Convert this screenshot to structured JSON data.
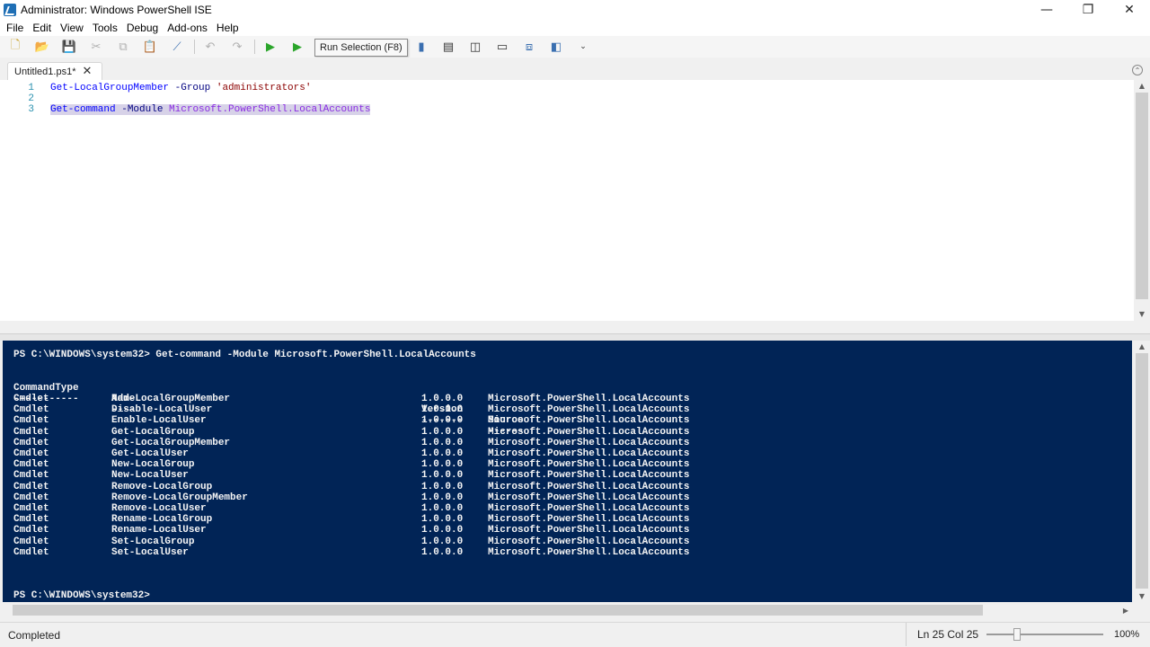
{
  "window": {
    "title": "Administrator: Windows PowerShell ISE",
    "minimize": "—",
    "restore": "❐",
    "close": "✕"
  },
  "menu": [
    "File",
    "Edit",
    "View",
    "Tools",
    "Debug",
    "Add-ons",
    "Help"
  ],
  "toolbar": {
    "tooltip": "Run Selection (F8)"
  },
  "tab": {
    "label": "Untitled1.ps1*",
    "close": "✕"
  },
  "editor": {
    "lines": [
      {
        "num": "1",
        "cmd": "Get-LocalGroupMember",
        "param": " -Group ",
        "arg": "'administrators'"
      },
      {
        "num": "2",
        "cmd": "",
        "param": "",
        "arg": ""
      },
      {
        "num": "3",
        "cmd": "Get-command",
        "param": " -Module ",
        "arg": "Microsoft.PowerShell.LocalAccounts"
      }
    ]
  },
  "console": {
    "command_line": "PS C:\\WINDOWS\\system32> Get-command -Module Microsoft.PowerShell.LocalAccounts",
    "headers": {
      "type": "CommandType",
      "name": "Name",
      "version": "Version",
      "source": "Source"
    },
    "underlines": {
      "type": "-----------",
      "name": "----",
      "version": "-------",
      "source": "------"
    },
    "rows": [
      {
        "type": "Cmdlet",
        "name": "Add-LocalGroupMember",
        "version": "1.0.0.0",
        "source": "Microsoft.PowerShell.LocalAccounts"
      },
      {
        "type": "Cmdlet",
        "name": "Disable-LocalUser",
        "version": "1.0.0.0",
        "source": "Microsoft.PowerShell.LocalAccounts"
      },
      {
        "type": "Cmdlet",
        "name": "Enable-LocalUser",
        "version": "1.0.0.0",
        "source": "Microsoft.PowerShell.LocalAccounts"
      },
      {
        "type": "Cmdlet",
        "name": "Get-LocalGroup",
        "version": "1.0.0.0",
        "source": "Microsoft.PowerShell.LocalAccounts"
      },
      {
        "type": "Cmdlet",
        "name": "Get-LocalGroupMember",
        "version": "1.0.0.0",
        "source": "Microsoft.PowerShell.LocalAccounts"
      },
      {
        "type": "Cmdlet",
        "name": "Get-LocalUser",
        "version": "1.0.0.0",
        "source": "Microsoft.PowerShell.LocalAccounts"
      },
      {
        "type": "Cmdlet",
        "name": "New-LocalGroup",
        "version": "1.0.0.0",
        "source": "Microsoft.PowerShell.LocalAccounts"
      },
      {
        "type": "Cmdlet",
        "name": "New-LocalUser",
        "version": "1.0.0.0",
        "source": "Microsoft.PowerShell.LocalAccounts"
      },
      {
        "type": "Cmdlet",
        "name": "Remove-LocalGroup",
        "version": "1.0.0.0",
        "source": "Microsoft.PowerShell.LocalAccounts"
      },
      {
        "type": "Cmdlet",
        "name": "Remove-LocalGroupMember",
        "version": "1.0.0.0",
        "source": "Microsoft.PowerShell.LocalAccounts"
      },
      {
        "type": "Cmdlet",
        "name": "Remove-LocalUser",
        "version": "1.0.0.0",
        "source": "Microsoft.PowerShell.LocalAccounts"
      },
      {
        "type": "Cmdlet",
        "name": "Rename-LocalGroup",
        "version": "1.0.0.0",
        "source": "Microsoft.PowerShell.LocalAccounts"
      },
      {
        "type": "Cmdlet",
        "name": "Rename-LocalUser",
        "version": "1.0.0.0",
        "source": "Microsoft.PowerShell.LocalAccounts"
      },
      {
        "type": "Cmdlet",
        "name": "Set-LocalGroup",
        "version": "1.0.0.0",
        "source": "Microsoft.PowerShell.LocalAccounts"
      },
      {
        "type": "Cmdlet",
        "name": "Set-LocalUser",
        "version": "1.0.0.0",
        "source": "Microsoft.PowerShell.LocalAccounts"
      }
    ],
    "prompt": "PS C:\\WINDOWS\\system32>"
  },
  "status": {
    "text": "Completed",
    "position": "Ln 25  Col 25",
    "zoom": "100%"
  },
  "colors": {
    "console_bg": "#012456",
    "console_fg": "#f5f5f5",
    "cmdlet": "#0000ff",
    "string": "#8b0000",
    "argument": "#8a2be2",
    "line_numbers": "#2b91af"
  }
}
